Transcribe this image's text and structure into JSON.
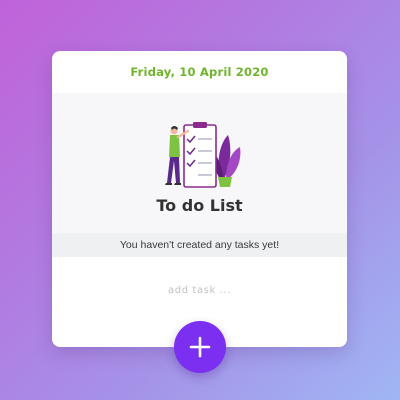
{
  "header": {
    "date": "Friday, 10 April 2020"
  },
  "hero": {
    "illustration_icon": "checklist-illustration-icon"
  },
  "main": {
    "title": "To do List",
    "empty_message": "You haven't created any tasks yet!"
  },
  "task_input": {
    "placeholder": "add task ...",
    "value": ""
  },
  "fab": {
    "icon": "plus-icon"
  },
  "colors": {
    "accent": "#7b2ff0",
    "date_text": "#6fb52b",
    "background_start": "#c062d9",
    "background_end": "#a0b6f4",
    "empty_bar": "#eef0f2"
  }
}
